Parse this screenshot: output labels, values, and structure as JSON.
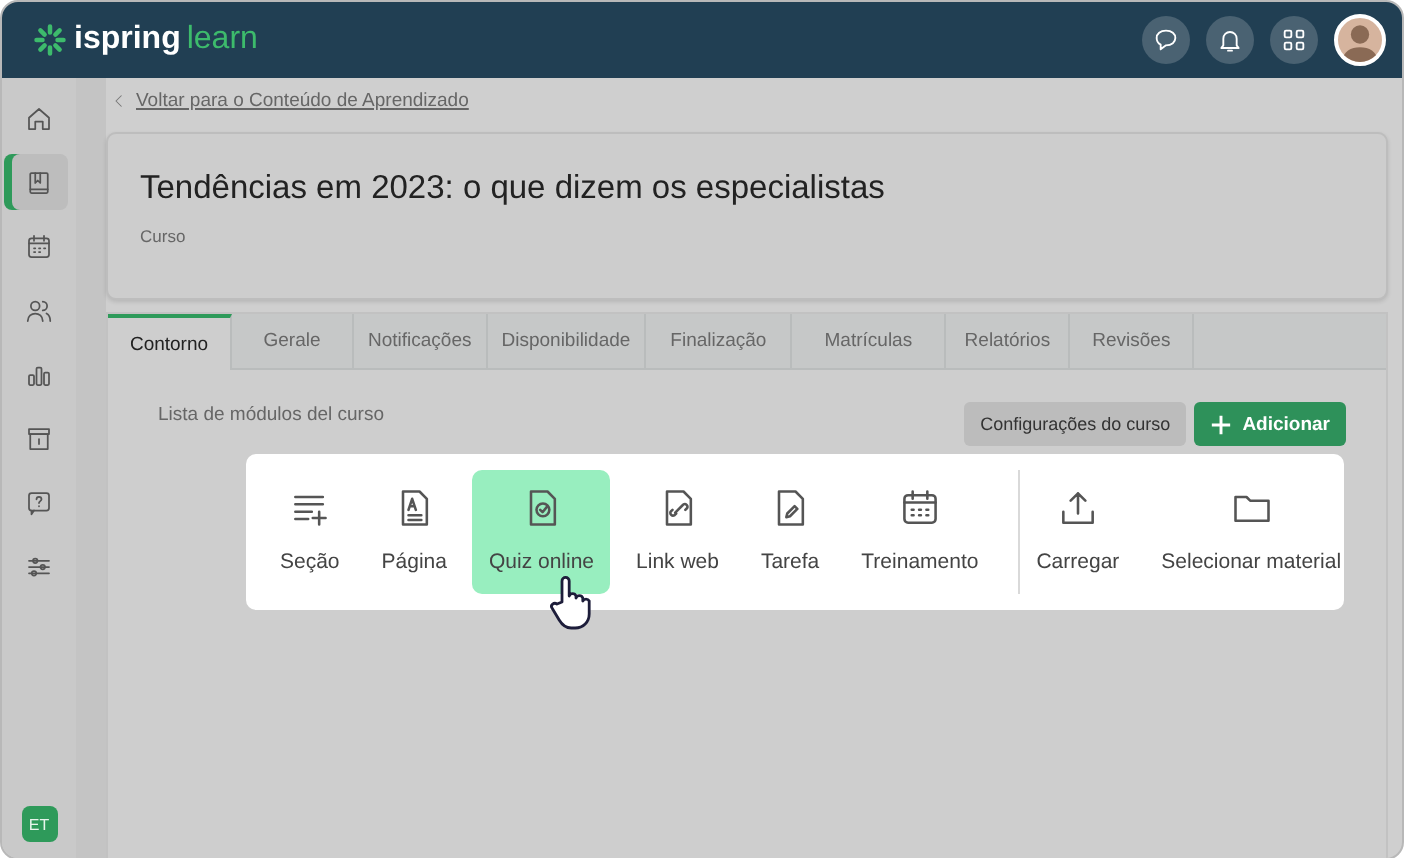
{
  "header": {
    "logo_left": "ispring",
    "logo_right": "learn"
  },
  "sidebar": {
    "items": [
      {
        "selected": false
      },
      {
        "selected": true
      },
      {
        "selected": false
      },
      {
        "selected": false
      },
      {
        "selected": false
      },
      {
        "selected": false
      },
      {
        "selected": false
      },
      {
        "selected": false
      }
    ],
    "user_badge": "ET"
  },
  "back_link": "Voltar para o Conteúdo de Aprendizado",
  "course": {
    "title": "Tendências em 2023: o que dizem os especialistas",
    "type": "Curso"
  },
  "tabs": [
    {
      "label": "Contorno",
      "selected": true
    },
    {
      "label": "Gerale",
      "selected": false
    },
    {
      "label": "Notificações",
      "selected": false
    },
    {
      "label": "Disponibilidade",
      "selected": false
    },
    {
      "label": "Finalização",
      "selected": false
    },
    {
      "label": "Matrículas",
      "selected": false
    },
    {
      "label": "Relatórios",
      "selected": false
    },
    {
      "label": "Revisões",
      "selected": false
    }
  ],
  "modules_label": "Lista de módulos del curso",
  "settings_button": "Configurações do curso",
  "add_button": "Adicionar",
  "add_menu": [
    {
      "label": "Seção",
      "selected": false,
      "divider_before": false
    },
    {
      "label": "Página",
      "selected": false,
      "divider_before": false
    },
    {
      "label": "Quiz online",
      "selected": true,
      "divider_before": false
    },
    {
      "label": "Link web",
      "selected": false,
      "divider_before": false
    },
    {
      "label": "Tarefa",
      "selected": false,
      "divider_before": false
    },
    {
      "label": "Treinamento",
      "selected": false,
      "divider_before": false
    },
    {
      "label": "Carregar",
      "selected": false,
      "divider_before": true
    },
    {
      "label": "Selecionar material",
      "selected": false,
      "divider_before": false
    }
  ]
}
